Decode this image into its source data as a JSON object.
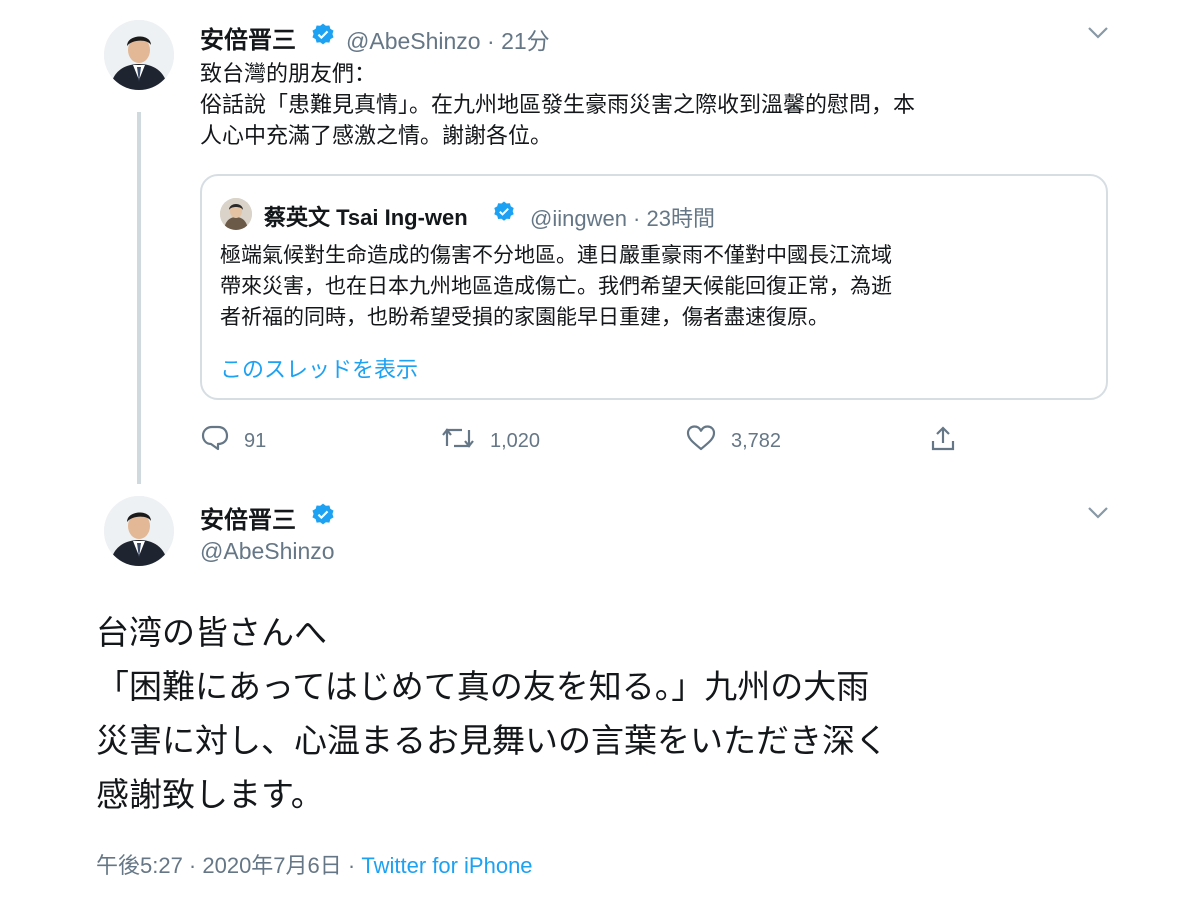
{
  "reply_tweet": {
    "author_name": "安倍晋三",
    "handle": "@AbeShinzo",
    "time": "21分",
    "text_lines": [
      "致台灣的朋友們：",
      "俗話說「患難見真情」。在九州地區發生豪雨災害之際收到溫馨的慰問，本",
      "人心中充滿了感激之情。謝謝各位。"
    ],
    "quoted": {
      "author_name": "蔡英文 Tsai Ing-wen",
      "handle": "@iingwen",
      "time": "23時間",
      "text_lines": [
        "極端氣候對生命造成的傷害不分地區。連日嚴重豪雨不僅對中國長江流域",
        "帶來災害，也在日本九州地區造成傷亡。我們希望天候能回復正常，為逝",
        "者祈福的同時，也盼希望受損的家園能早日重建，傷者盡速復原。"
      ],
      "thread_link": "このスレッドを表示"
    },
    "actions": {
      "replies": "91",
      "retweets": "1,020",
      "likes": "3,782"
    }
  },
  "main_tweet": {
    "author_name": "安倍晋三",
    "handle": "@AbeShinzo",
    "text_lines": [
      "台湾の皆さんへ",
      "「困難にあってはじめて真の友を知る。」九州の大雨",
      "災害に対し、心温まるお見舞いの言葉をいただき深く",
      "感謝致します。"
    ],
    "timestamp": "午後5:27 · 2020年7月6日",
    "separator": " · ",
    "source": "Twitter for iPhone"
  },
  "icons": {
    "verified": "verified-badge-icon",
    "caret": "chevron-down-icon",
    "reply": "reply-bubble-icon",
    "retweet": "retweet-icon",
    "like": "heart-icon",
    "share": "share-icon"
  },
  "colors": {
    "accent": "#1da1f2",
    "secondary_text": "#657786",
    "primary_text": "#14171a",
    "border": "#d6dee4"
  }
}
